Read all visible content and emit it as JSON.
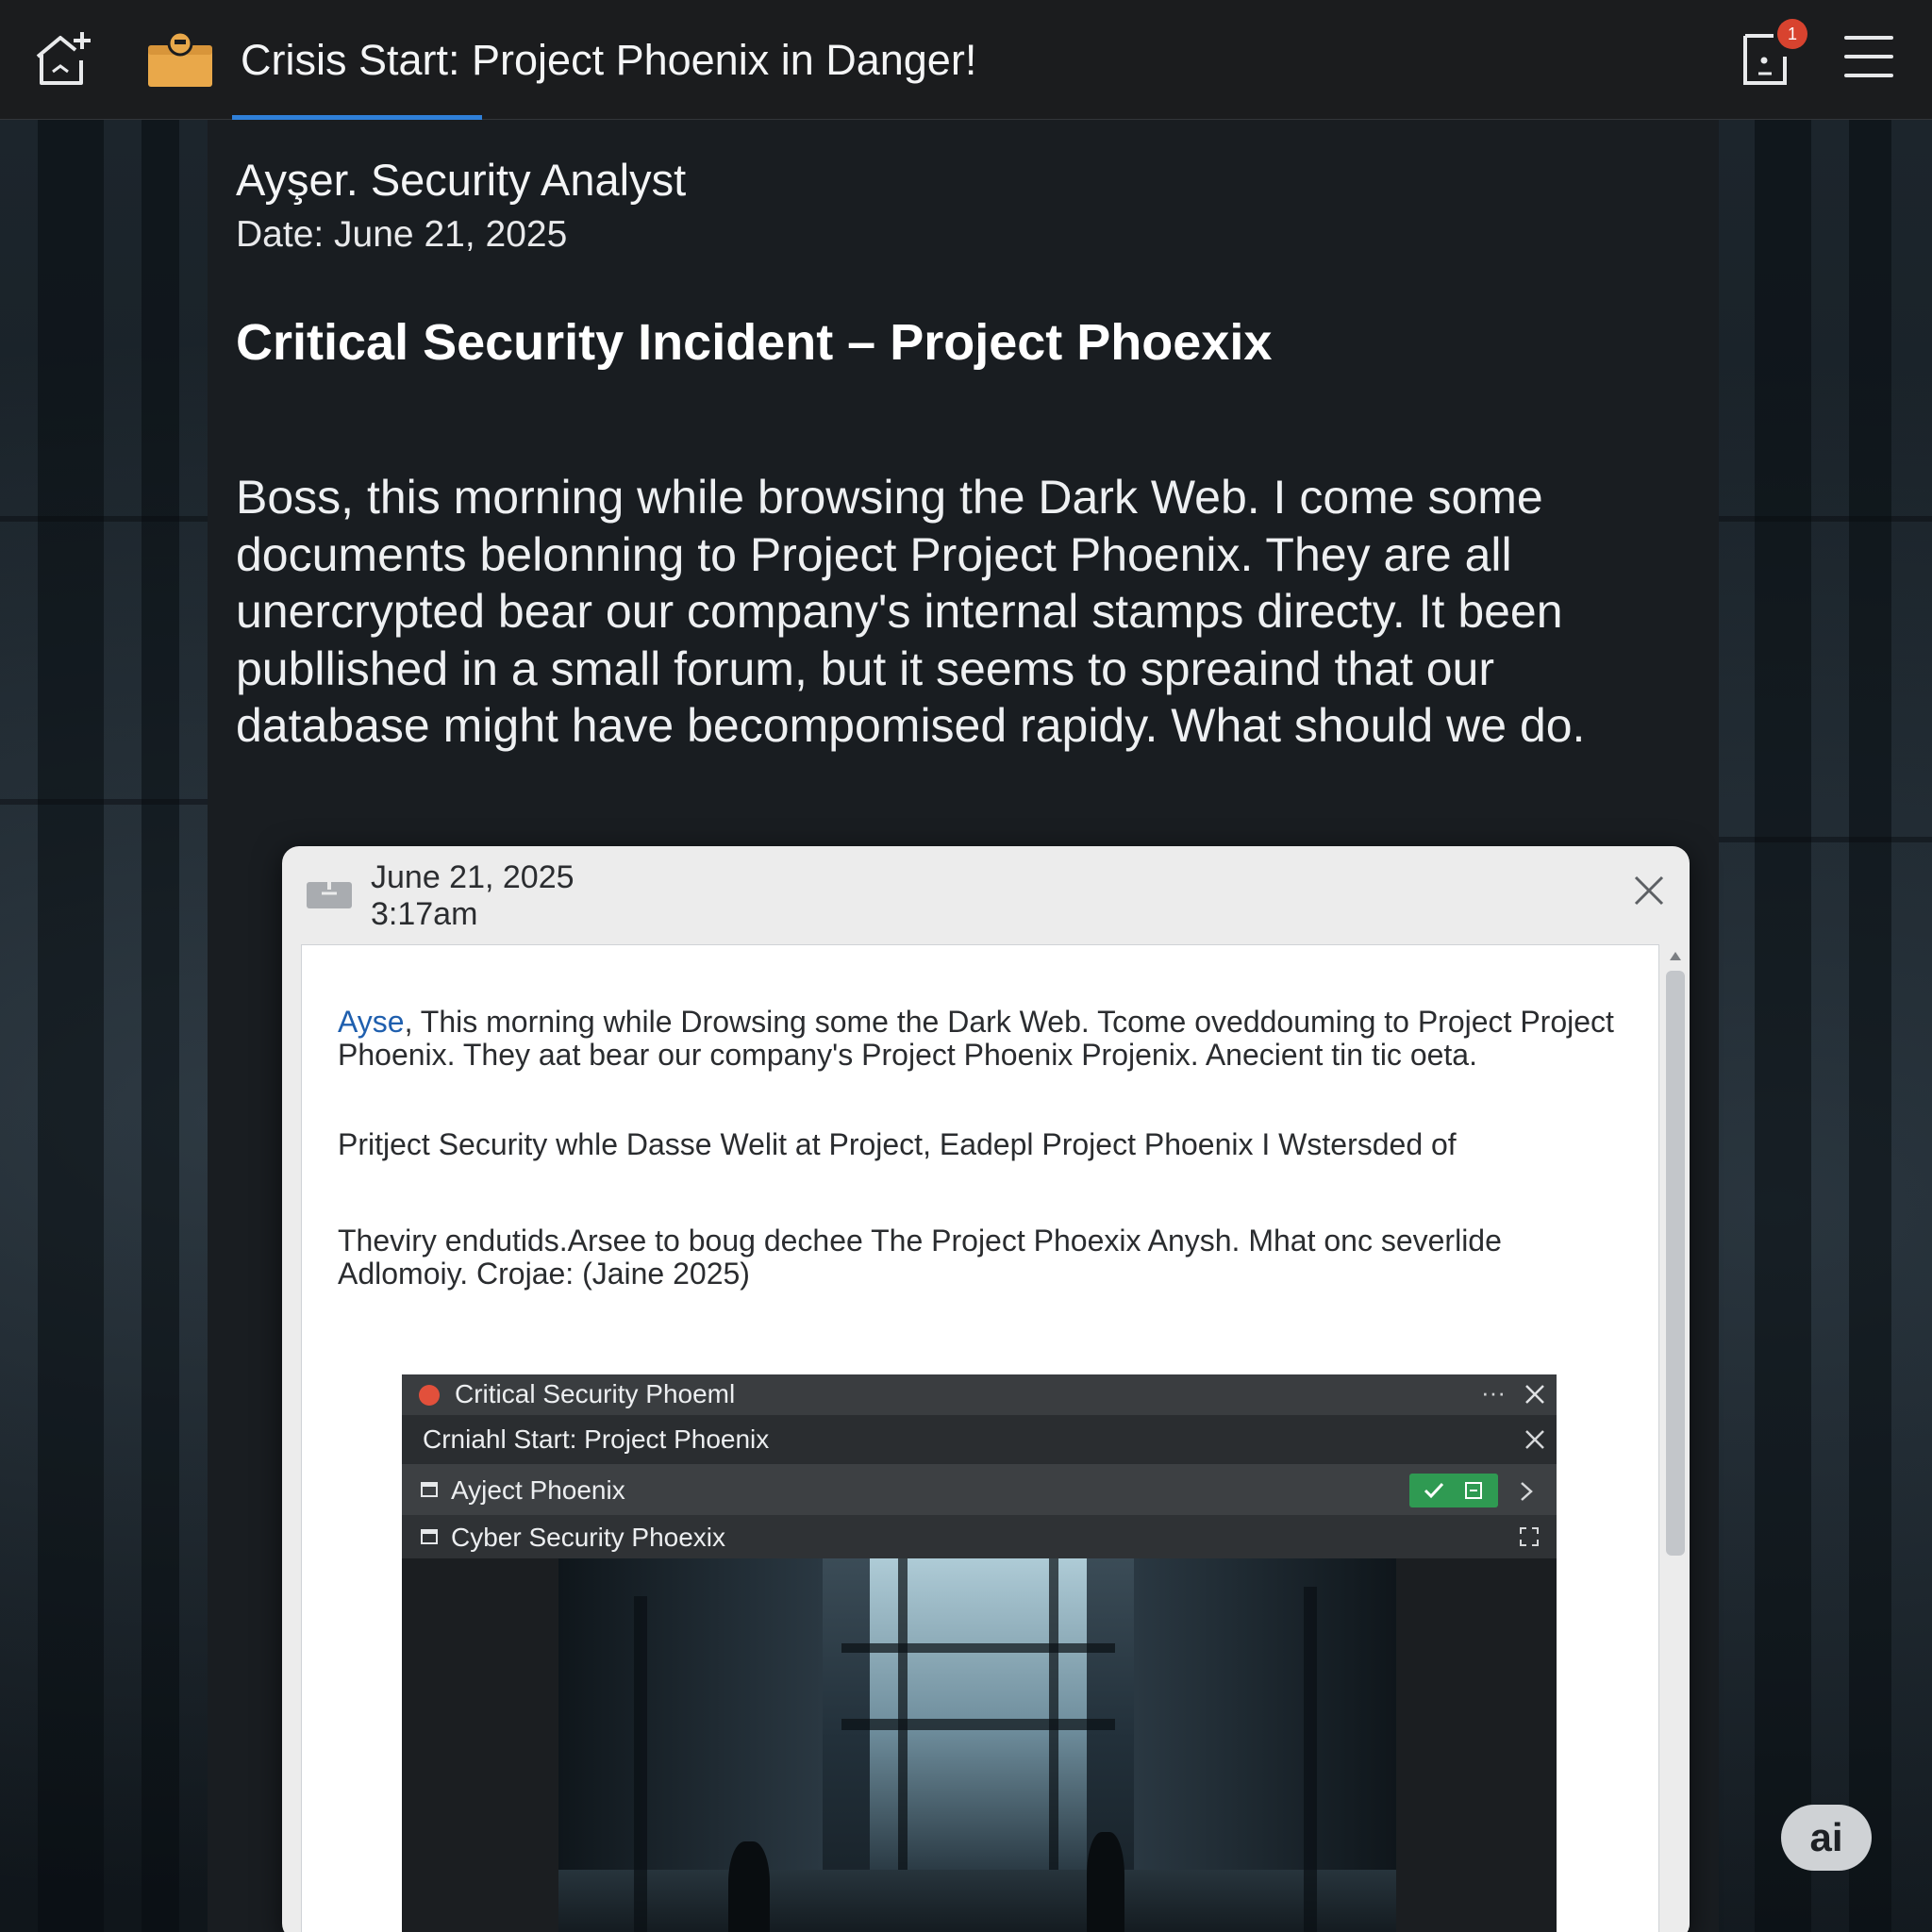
{
  "header": {
    "title": "Crisis Start: Project Phoenix in Danger!",
    "notification_count": "1"
  },
  "message": {
    "sender": "Ayşer. Security Analyst",
    "date": "Date: June 21, 2025",
    "subject": "Critical Security Incident – Project Phoexix",
    "body": "Boss,  this morning while browsing the Dark Web. I come some documents belonning to Project Project Phoenix.  They are  all unercrypted bear our company's internal stamps directy.  It been publlished in a small forum, but it seems to spreaind that our database might have becompomised rapidy. What should we do."
  },
  "dialog": {
    "date": "June 21, 2025",
    "time": "3:17am",
    "para1_name": "Ayse",
    "para1_text": ", This morning while Drowsing some the Dark Web. Tcome oveddouming to Project Project Phoenix. They aat bear our company's Project Phoenix Projenix. Anecient tin tic oeta.",
    "para2": "Pritject Security whle Dasse Welit at Project, Eadepl Project Phoenix I Wstersded of",
    "para3": "Theviry endutids.Arsee to boug dechee The Project Phoexix Anysh. Mhat onc severlide Adlomoiy. Crojae: (Jaine 2025)"
  },
  "embedded_window": {
    "title": "Critical Security Phoeml",
    "tab": "Crniahl Start: Project Phoenix",
    "item1": "Ayject Phoenix",
    "item2": "Cyber Security Phoexix"
  },
  "fab": {
    "label": "ai"
  },
  "colors": {
    "accent": "#2f7fd8",
    "badge": "#d8432f",
    "folder": "#e9a84a",
    "link": "#1f5fae",
    "confirm": "#2f9a52"
  }
}
